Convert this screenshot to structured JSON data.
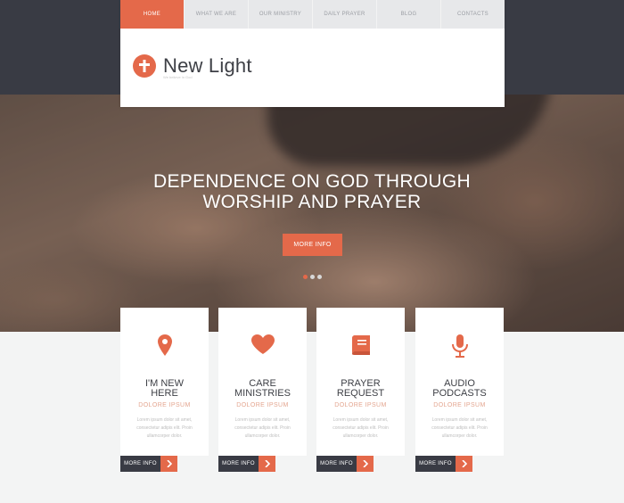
{
  "nav": {
    "items": [
      {
        "label": "Home"
      },
      {
        "label": "What we are"
      },
      {
        "label": "Our Ministry"
      },
      {
        "label": "Daily Prayer"
      },
      {
        "label": "Blog"
      },
      {
        "label": "Contacts"
      }
    ],
    "active_index": 0
  },
  "logo": {
    "title": "New Light",
    "tagline": "We believe in God"
  },
  "hero": {
    "title_line1": "DEPENDENCE ON GOD THROUGH",
    "title_line2": "WORSHIP AND PRAYER",
    "button_label": "MORE INFO",
    "slides": 3,
    "active_slide": 0
  },
  "cards": [
    {
      "icon": "map-pin-icon",
      "title_line1": "I'M NEW",
      "title_line2": "HERE",
      "subtitle": "DOLORE IPSUM",
      "text": "Lorem ipsum dolor sit amet, consectetur adipis elit. Proin ullamcorper dolor."
    },
    {
      "icon": "heart-icon",
      "title_line1": "CARE",
      "title_line2": "MINISTRIES",
      "subtitle": "DOLORE IPSUM",
      "text": "Lorem ipsum dolor sit amet, consectetur adipis elit. Proin ullamcorper dolor."
    },
    {
      "icon": "book-icon",
      "title_line1": "PRAYER",
      "title_line2": "REQUEST",
      "subtitle": "DOLORE IPSUM",
      "text": "Lorem ipsum dolor sit amet, consectetur adipis elit. Proin ullamcorper dolor."
    },
    {
      "icon": "microphone-icon",
      "title_line1": "AUDIO",
      "title_line2": "PODCASTS",
      "subtitle": "DOLORE IPSUM",
      "text": "Lorem ipsum dolor sit amet, consectetur adipis elit. Proin ullamcorper dolor."
    }
  ],
  "card_button_label": "MORE INFO",
  "colors": {
    "accent": "#e4694a",
    "dark": "#393b44",
    "background": "#f3f4f4"
  }
}
